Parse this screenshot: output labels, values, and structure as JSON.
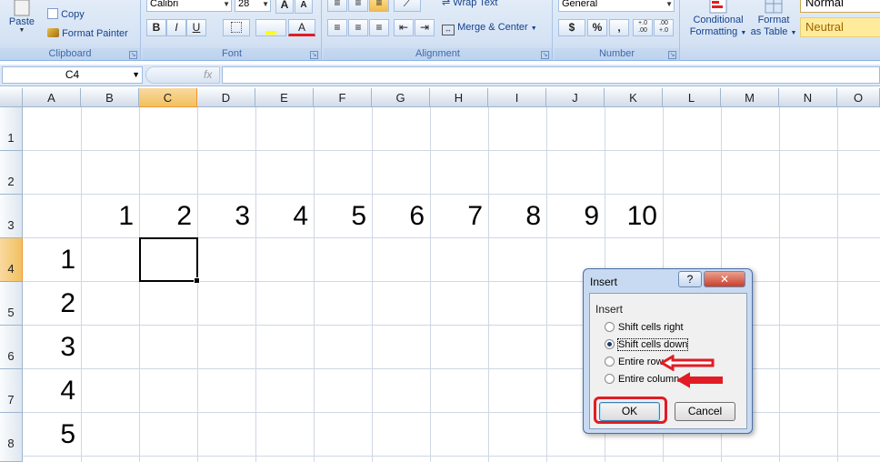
{
  "ribbon": {
    "clipboard": {
      "paste": "Paste",
      "copy": "Copy",
      "format_painter": "Format Painter",
      "label": "Clipboard"
    },
    "font": {
      "name": "Calibri",
      "size": "28",
      "grow": "A",
      "shrink": "A",
      "bold": "B",
      "italic": "I",
      "underline": "U",
      "font_color": "A",
      "label": "Font"
    },
    "alignment": {
      "wrap_text": "Wrap Text",
      "merge_center": "Merge & Center",
      "label": "Alignment"
    },
    "number": {
      "format": "General",
      "currency": "$",
      "percent": "%",
      "comma": ",",
      "inc_decimal": "+.0 .00",
      "dec_decimal": ".00 +.0",
      "label": "Number"
    },
    "styles": {
      "conditional": "Conditional",
      "formatting": "Formatting",
      "format": "Format",
      "as_table": "as Table",
      "normal": "Normal",
      "neutral": "Neutral"
    }
  },
  "formula_bar": {
    "name_box": "C4",
    "fx": "fx",
    "value": ""
  },
  "sheet": {
    "columns": [
      "A",
      "B",
      "C",
      "D",
      "E",
      "F",
      "G",
      "H",
      "I",
      "J",
      "K",
      "L",
      "M",
      "N",
      "O"
    ],
    "rows": [
      "1",
      "2",
      "3",
      "4",
      "5",
      "6",
      "7",
      "8"
    ],
    "row3_values": [
      "1",
      "2",
      "3",
      "4",
      "5",
      "6",
      "7",
      "8",
      "9",
      "10"
    ],
    "colA_values": [
      "1",
      "2",
      "3",
      "4",
      "5"
    ],
    "active_cell": "C4"
  },
  "dialog": {
    "title": "Insert",
    "help": "?",
    "close": "✕",
    "group": "Insert",
    "options": [
      {
        "label": "Shift cells right",
        "checked": false
      },
      {
        "label": "Shift cells down",
        "checked": true
      },
      {
        "label": "Entire row",
        "checked": false
      },
      {
        "label": "Entire column",
        "checked": false
      }
    ],
    "ok": "OK",
    "cancel": "Cancel"
  },
  "colors": {
    "annotation_red": "#e21c24",
    "selection_header": "#f1c15f",
    "ribbon_bg": "#d4e2f4"
  }
}
